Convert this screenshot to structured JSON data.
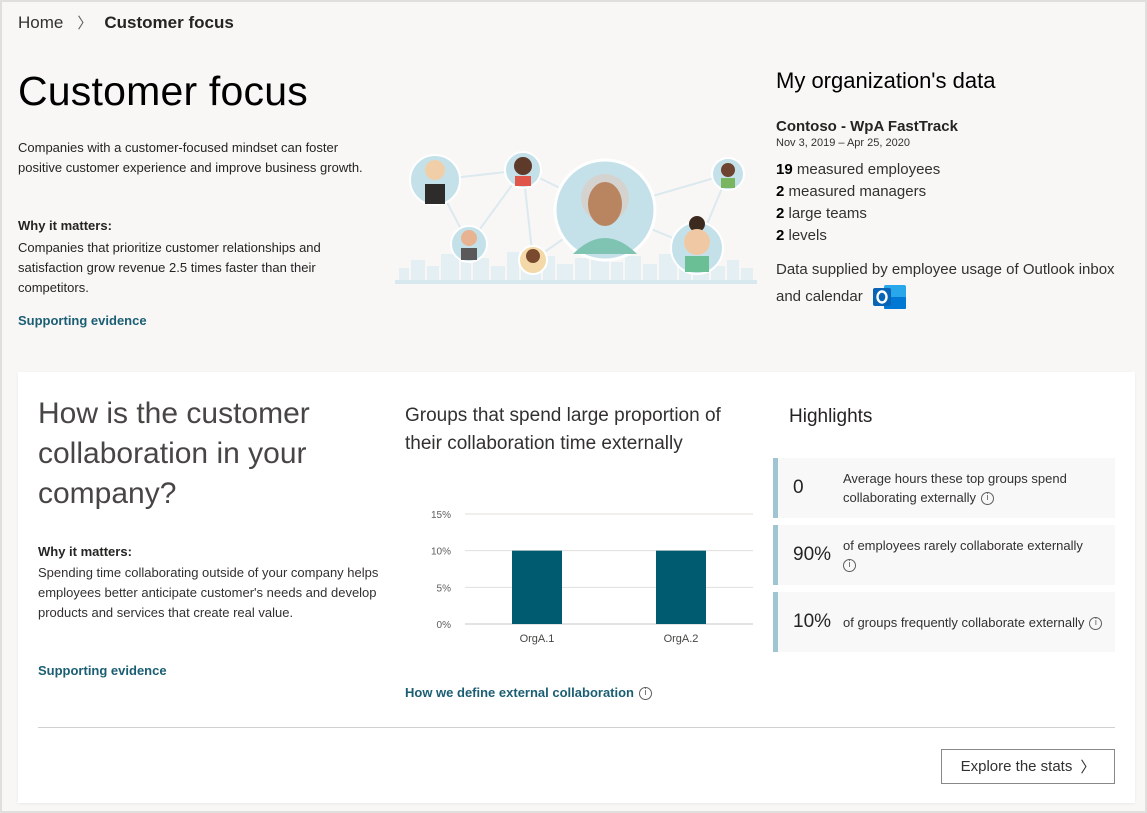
{
  "breadcrumb": {
    "home": "Home",
    "separator": "〉",
    "current": "Customer focus"
  },
  "hero": {
    "title": "Customer focus",
    "description": "Companies with a customer-focused mindset can foster positive customer experience and improve business growth.",
    "why_heading": "Why it matters:",
    "why_text": "Companies that prioritize customer relationships and satisfaction grow revenue 2.5 times faster than their competitors.",
    "link": "Supporting evidence"
  },
  "org": {
    "heading": "My organization's data",
    "name": "Contoso - WpA FastTrack",
    "dates": "Nov 3, 2019 – Apr 25, 2020",
    "stats": [
      {
        "value": "19",
        "label": " measured employees"
      },
      {
        "value": "2",
        "label": " measured managers"
      },
      {
        "value": "2",
        "label": " large teams"
      },
      {
        "value": "2",
        "label": " levels"
      }
    ],
    "note": "Data supplied by employee usage of Outlook inbox and calendar",
    "icon": "outlook-icon"
  },
  "section": {
    "title": "How is the customer collaboration in your company?",
    "why_heading": "Why it matters:",
    "why_text": "Spending time collaborating outside of your company helps employees better anticipate customer's needs and develop products and services that create real value.",
    "link": "Supporting evidence"
  },
  "chart_title": "Groups that spend large proportion of their collaboration time externally",
  "chart_link": "How we define external collaboration",
  "chart_data": {
    "type": "bar",
    "categories": [
      "OrgA.1",
      "OrgA.2"
    ],
    "values": [
      10,
      10
    ],
    "ylim": [
      0,
      15
    ],
    "yticks": [
      0,
      5,
      10,
      15
    ],
    "ytick_labels": [
      "0%",
      "5%",
      "10%",
      "15%"
    ],
    "grid": true,
    "bar_color": "#005b70"
  },
  "highlights": {
    "title": "Highlights",
    "items": [
      {
        "value": "0",
        "text": "Average hours these top groups spend collaborating externally"
      },
      {
        "value": "90%",
        "text": "of employees rarely collaborate externally"
      },
      {
        "value": "10%",
        "text": "of groups frequently collaborate externally"
      }
    ]
  },
  "explore_button": "Explore the stats",
  "colors": {
    "accent": "#1b5e73",
    "bar": "#005b70",
    "highlight_border": "#9fc5d3"
  }
}
